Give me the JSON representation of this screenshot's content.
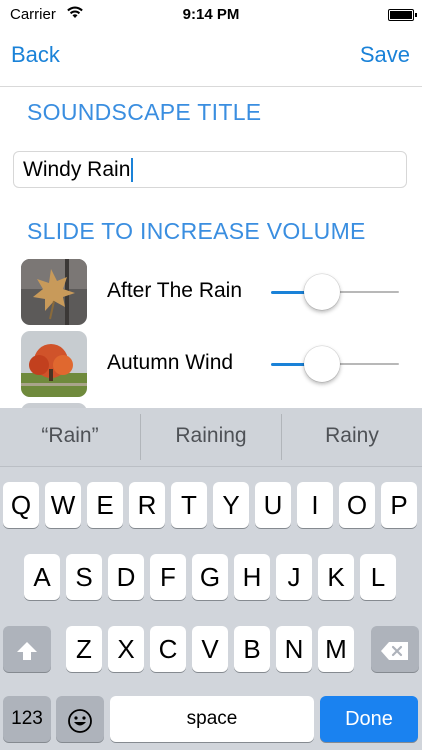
{
  "status_bar": {
    "carrier": "Carrier",
    "time": "9:14 PM"
  },
  "nav": {
    "back": "Back",
    "save": "Save"
  },
  "soundscape": {
    "title_header": "SOUNDSCAPE TITLE",
    "title_value": "Windy Rain",
    "volume_header": "SLIDE TO INCREASE VOLUME",
    "sounds": [
      {
        "name": "After The Rain",
        "volume": 0.3
      },
      {
        "name": "Autumn Wind",
        "volume": 0.3
      }
    ]
  },
  "keyboard": {
    "suggestions": [
      "“Rain”",
      "Raining",
      "Rainy"
    ],
    "row1": [
      "Q",
      "W",
      "E",
      "R",
      "T",
      "Y",
      "U",
      "I",
      "O",
      "P"
    ],
    "row2": [
      "A",
      "S",
      "D",
      "F",
      "G",
      "H",
      "J",
      "K",
      "L"
    ],
    "row3": [
      "Z",
      "X",
      "C",
      "V",
      "B",
      "N",
      "M"
    ],
    "numbers_key": "123",
    "space_key": "space",
    "done_key": "Done",
    "shift_icon": "shift-arrow-icon",
    "delete_icon": "backspace-icon",
    "emoji_icon": "emoji-icon"
  }
}
